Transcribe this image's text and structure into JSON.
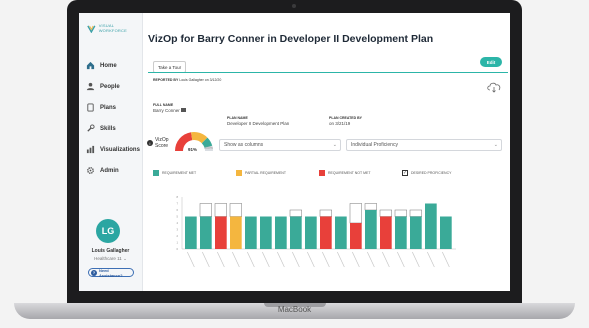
{
  "sidebar": {
    "logo_text": "VISUAL WORKFORCE",
    "items": [
      {
        "label": "Home",
        "icon": "home-icon"
      },
      {
        "label": "People",
        "icon": "person-icon"
      },
      {
        "label": "Plans",
        "icon": "clipboard-icon"
      },
      {
        "label": "Skills",
        "icon": "wrench-icon"
      },
      {
        "label": "Visualizations",
        "icon": "bar-chart-icon"
      },
      {
        "label": "Admin",
        "icon": "gear-icon"
      }
    ],
    "user": {
      "initials": "LG",
      "name": "Louis Gallagher",
      "role": "Healthcare 11"
    },
    "assist_label": "Need Assistance?"
  },
  "header": {
    "title": "VizOp for Barry Conner in Developer II Development Plan",
    "tour_label": "Take a Tour",
    "edit_label": "Edit",
    "reported_prefix": "REPORTED BY",
    "reported_value": "Louis Gallagher on 3/12/20"
  },
  "meta": {
    "full_name_label": "FULL NAME",
    "full_name": "Barry Conner",
    "plan_name_label": "PLAN NAME",
    "plan_name": "Developer II Development Plan",
    "plan_created_label": "PLAN CREATED BY",
    "plan_created": "on 3/21/19"
  },
  "vizop": {
    "label_line1": "VizOp",
    "label_line2": "Score",
    "score": "91%",
    "gauge_fraction": 0.91,
    "gauge_caption": "100%"
  },
  "filters": {
    "columns": "Show as columns",
    "proficiency": "Individual Proficiency"
  },
  "legend": [
    {
      "label": "REQUIREMENT MET",
      "color": "#3aaa98"
    },
    {
      "label": "PARTIAL REQUIREMENT",
      "color": "#f4b63f"
    },
    {
      "label": "REQUIREMENT NOT MET",
      "color": "#e8403a"
    },
    {
      "label": "DESIRED PROFICIENCY",
      "color": "#333333"
    }
  ],
  "colors": {
    "met": "#3aaa98",
    "partial": "#f4b63f",
    "notmet": "#e8403a",
    "accent": "#2cb5a8"
  },
  "base_label": "MacBook",
  "chart_data": {
    "type": "bar",
    "ylim": [
      0,
      8
    ],
    "y_ticks": [
      0,
      1,
      2,
      3,
      4,
      5,
      6,
      7,
      8
    ],
    "bars": [
      {
        "value": 5,
        "desired": 5,
        "status": "met"
      },
      {
        "value": 5,
        "desired": 7,
        "status": "met"
      },
      {
        "value": 5,
        "desired": 7,
        "status": "notmet"
      },
      {
        "value": 5,
        "desired": 7,
        "status": "partial"
      },
      {
        "value": 5,
        "desired": 5,
        "status": "met"
      },
      {
        "value": 5,
        "desired": 5,
        "status": "met"
      },
      {
        "value": 5,
        "desired": 5,
        "status": "met"
      },
      {
        "value": 5,
        "desired": 6,
        "status": "met"
      },
      {
        "value": 5,
        "desired": 5,
        "status": "met"
      },
      {
        "value": 5,
        "desired": 6,
        "status": "notmet"
      },
      {
        "value": 5,
        "desired": 5,
        "status": "met"
      },
      {
        "value": 4,
        "desired": 7,
        "status": "notmet"
      },
      {
        "value": 6,
        "desired": 7,
        "status": "met"
      },
      {
        "value": 5,
        "desired": 6,
        "status": "notmet"
      },
      {
        "value": 5,
        "desired": 6,
        "status": "met"
      },
      {
        "value": 5,
        "desired": 6,
        "status": "met"
      },
      {
        "value": 7,
        "desired": 7,
        "status": "met"
      },
      {
        "value": 5,
        "desired": 5,
        "status": "met"
      }
    ]
  }
}
